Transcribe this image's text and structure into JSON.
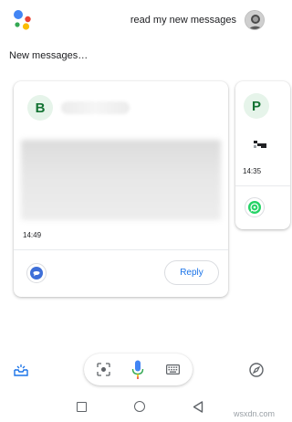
{
  "header": {
    "assistant_logo_icon": "google-assistant-logo",
    "query": "read my new messages",
    "avatar_icon": "user-avatar"
  },
  "section_title": "New messages…",
  "cards": [
    {
      "initial": "B",
      "time": "14:49",
      "app_icon": "samsung-messages-icon",
      "reply_label": "Reply"
    },
    {
      "initial": "P",
      "time": "14:35",
      "app_icon": "whatsapp-icon"
    }
  ],
  "bottom_bar": {
    "left_icon": "tray-icon",
    "lens_icon": "lens-icon",
    "mic_icon": "mic-icon",
    "keyboard_icon": "keyboard-icon",
    "right_icon": "compass-icon"
  },
  "nav_bar": {
    "recents_icon": "recents-icon",
    "home_icon": "home-icon",
    "back_icon": "back-icon"
  },
  "watermark": "wsxdn.com",
  "colors": {
    "initial_bg": "#e6f4ea",
    "initial_fg": "#137333",
    "reply_text": "#1a73e8",
    "whatsapp": "#25d366",
    "samsung_messages": "#3e6fd8"
  }
}
